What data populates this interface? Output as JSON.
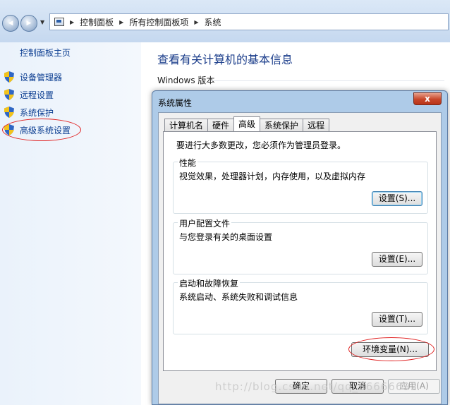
{
  "address": {
    "crumbs": [
      "控制面板",
      "所有控制面板项",
      "系统"
    ],
    "back_glyph": "◀",
    "forward_glyph": "▶",
    "dropdown_glyph": "▼",
    "separator_glyph": "▶"
  },
  "sidebar": {
    "home_label": "控制面板主页",
    "items": [
      {
        "label": "设备管理器",
        "icon": "uac-shield-icon"
      },
      {
        "label": "远程设置",
        "icon": "uac-shield-icon"
      },
      {
        "label": "系统保护",
        "icon": "uac-shield-icon"
      },
      {
        "label": "高级系统设置",
        "icon": "uac-shield-icon"
      }
    ]
  },
  "main": {
    "title": "查看有关计算机的基本信息",
    "section_heading": "Windows 版本"
  },
  "dialog": {
    "title": "系统属性",
    "close_glyph": "x",
    "tabs": [
      "计算机名",
      "硬件",
      "高级",
      "系统保护",
      "远程"
    ],
    "active_tab": "高级",
    "note": "要进行大多数更改，您必须作为管理员登录。",
    "groups": [
      {
        "label": "性能",
        "desc": "视觉效果，处理器计划，内存使用，以及虚拟内存",
        "button": "设置(S)..."
      },
      {
        "label": "用户配置文件",
        "desc": "与您登录有关的桌面设置",
        "button": "设置(E)..."
      },
      {
        "label": "启动和故障恢复",
        "desc": "系统启动、系统失败和调试信息",
        "button": "设置(T)..."
      }
    ],
    "env_button": "环境变量(N)...",
    "ok_button": "确定",
    "cancel_button": "取消",
    "apply_button": "应用(A)"
  },
  "watermark": "http://blog.csdn.net/qq_36666692",
  "colors": {
    "link": "#0b3d91",
    "title_blue": "#1a3c8a",
    "annotation_red": "#e02020",
    "dialog_frame": "#aecbe8"
  }
}
